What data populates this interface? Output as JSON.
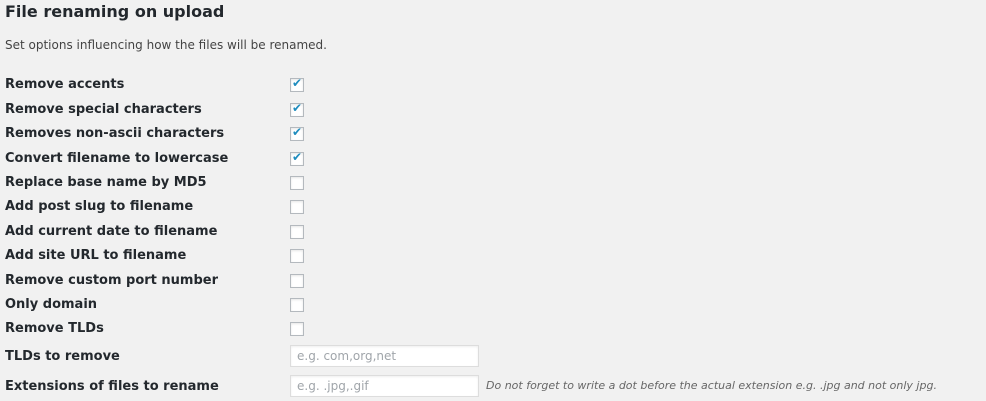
{
  "section": {
    "title": "File renaming on upload",
    "description": "Set options influencing how the files will be renamed."
  },
  "options": [
    {
      "label": "Remove accents",
      "checked": true
    },
    {
      "label": "Remove special characters",
      "checked": true
    },
    {
      "label": "Removes non-ascii characters",
      "checked": true
    },
    {
      "label": "Convert filename to lowercase",
      "checked": true
    },
    {
      "label": "Replace base name by MD5",
      "checked": false
    },
    {
      "label": "Add post slug to filename",
      "checked": false
    },
    {
      "label": "Add current date to filename",
      "checked": false
    },
    {
      "label": "Add site URL to filename",
      "checked": false
    },
    {
      "label": "Remove custom port number",
      "checked": false
    },
    {
      "label": "Only domain",
      "checked": false
    },
    {
      "label": "Remove TLDs",
      "checked": false
    }
  ],
  "tlds_field": {
    "label": "TLDs to remove",
    "value": "",
    "placeholder": "e.g. com,org,net"
  },
  "extensions_field": {
    "label": "Extensions of files to rename",
    "value": "",
    "placeholder": "e.g. .jpg,.gif",
    "note": "Do not forget to write a dot before the actual extension e.g. .jpg and not only jpg."
  },
  "colors": {
    "checkmark": "#1e8cbe",
    "background": "#f1f1f1"
  }
}
